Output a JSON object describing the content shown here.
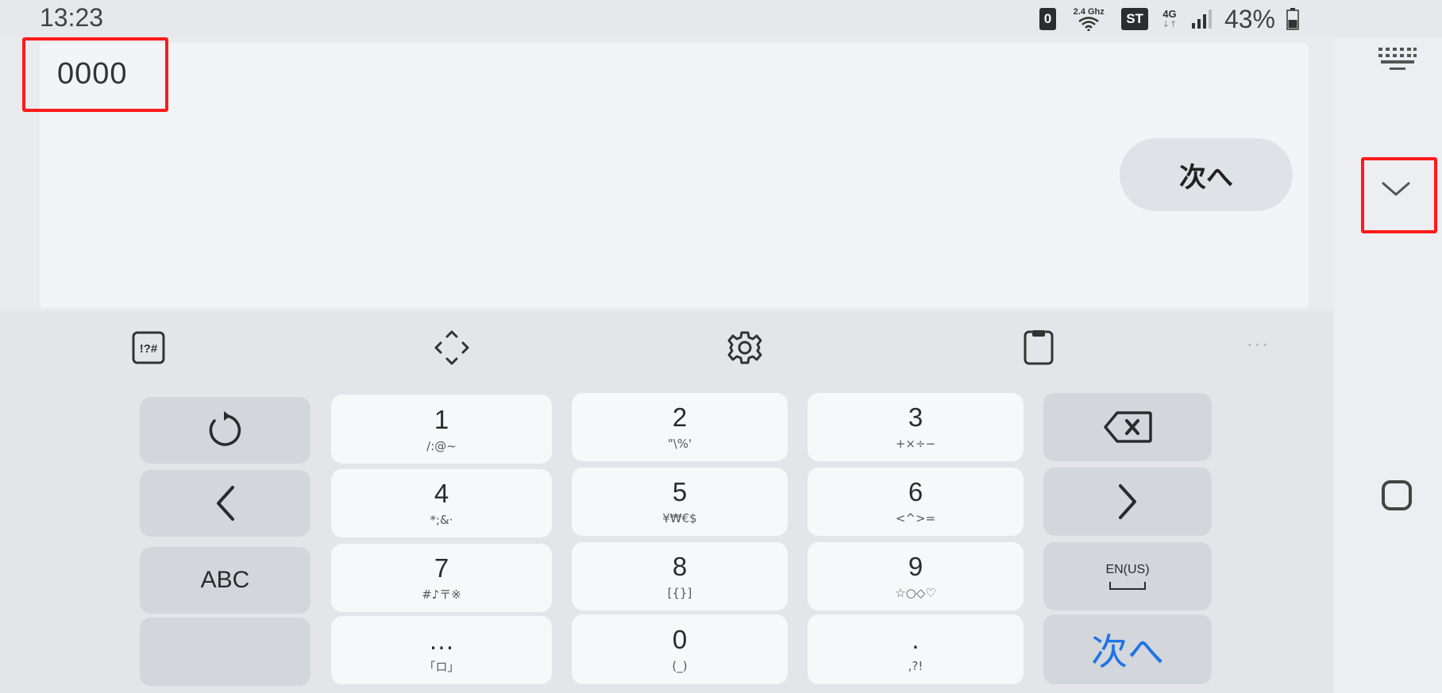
{
  "status_bar": {
    "time": "13:23",
    "badge_1": "0",
    "wifi_band": "2.4 Ghz",
    "badge_2": "ST",
    "network": "4G",
    "network_arrows": "↓↑",
    "battery": "43%"
  },
  "input": {
    "value": "0000",
    "next_label": "次へ"
  },
  "toolbar": {
    "icons": [
      "symbols-icon",
      "cursor-move-icon",
      "settings-gear-icon",
      "clipboard-icon",
      "more-icon"
    ],
    "symbols_label": "!?#",
    "more_label": "···"
  },
  "keys": {
    "k1": {
      "main": "1",
      "sub": "/:@~"
    },
    "k2": {
      "main": "2",
      "sub": "\"\\%'"
    },
    "k3": {
      "main": "3",
      "sub": "+×÷−"
    },
    "k4": {
      "main": "4",
      "sub": "*;&·"
    },
    "k5": {
      "main": "5",
      "sub": "¥₩€$"
    },
    "k6": {
      "main": "6",
      "sub": "<^>="
    },
    "k7": {
      "main": "7",
      "sub": "#♪〒※"
    },
    "k8": {
      "main": "8",
      "sub": "[{}]"
    },
    "k9": {
      "main": "9",
      "sub": "☆○◇♡"
    },
    "kdots": {
      "main": "…",
      "sub": "「ロ」"
    },
    "k0": {
      "main": "0",
      "sub": "(_)"
    },
    "kperiod": {
      "main": ".",
      "sub": ",?!"
    },
    "abc": "ABC",
    "lang": "EN(US)",
    "enter": "次へ"
  },
  "colors": {
    "highlight": "#ff1a1a",
    "enter_blue": "#1f74e6"
  }
}
